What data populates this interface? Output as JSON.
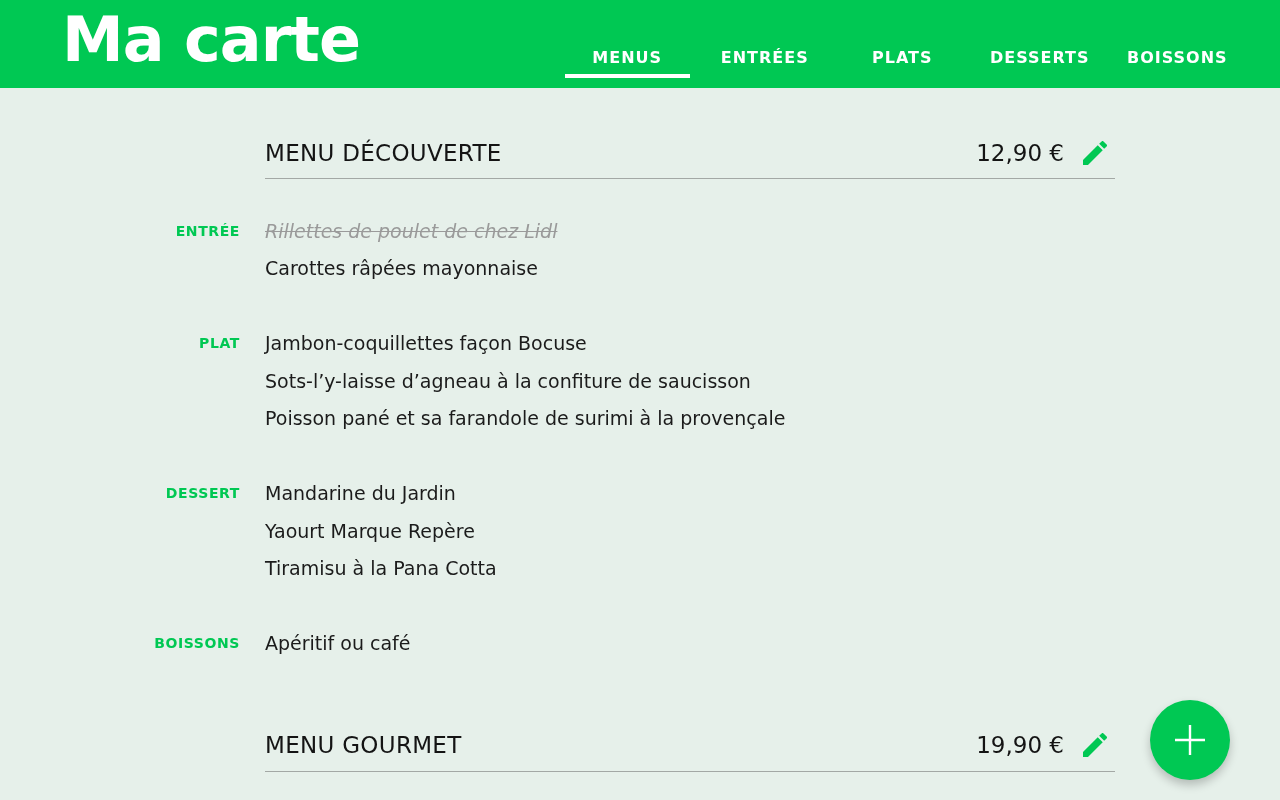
{
  "app_bar": {
    "title": "Ma carte",
    "tabs": [
      {
        "label": "MENUS",
        "selected": true
      },
      {
        "label": "ENTRÉES",
        "selected": false
      },
      {
        "label": "PLATS",
        "selected": false
      },
      {
        "label": "DESSERTS",
        "selected": false
      },
      {
        "label": "BOISSONS",
        "selected": false
      }
    ]
  },
  "menus": [
    {
      "title": "MENU DÉCOUVERTE",
      "price": "12,90 €",
      "sections": [
        {
          "label": "ENTRÉE",
          "dishes": [
            {
              "name": "Rillettes de poulet de chez Lidl",
              "crossed_out": true
            },
            {
              "name": "Carottes râpées mayonnaise",
              "crossed_out": false
            }
          ]
        },
        {
          "label": "PLAT",
          "dishes": [
            {
              "name": "Jambon-coquillettes façon Bocuse",
              "crossed_out": false
            },
            {
              "name": "Sots-l’y-laisse d’agneau à la confiture de saucisson",
              "crossed_out": false
            },
            {
              "name": "Poisson pané et sa farandole de surimi à la provençale",
              "crossed_out": false
            }
          ]
        },
        {
          "label": "DESSERT",
          "dishes": [
            {
              "name": "Mandarine du Jardin",
              "crossed_out": false
            },
            {
              "name": "Yaourt Marque Repère",
              "crossed_out": false
            },
            {
              "name": "Tiramisu à la Pana Cotta",
              "crossed_out": false
            }
          ]
        },
        {
          "label": "BOISSONS",
          "dishes": [
            {
              "name": "Apéritif ou café",
              "crossed_out": false
            }
          ]
        }
      ]
    },
    {
      "title": "MENU GOURMET",
      "price": "19,90 €"
    }
  ]
}
